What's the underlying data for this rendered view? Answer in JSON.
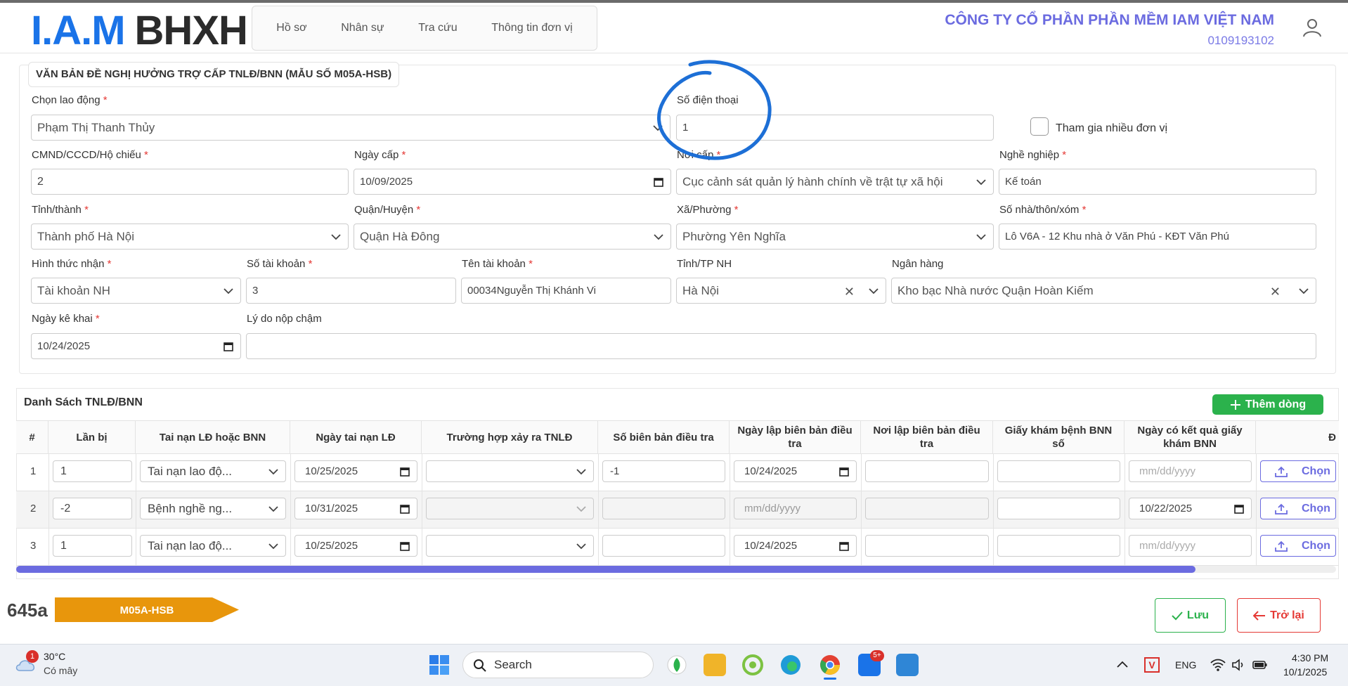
{
  "header": {
    "logo_iam": "I.A.M",
    "logo_bhxh": "BHXH",
    "nav": [
      "Hồ sơ",
      "Nhân sự",
      "Tra cứu",
      "Thông tin đơn vị"
    ],
    "company": "CÔNG TY CỔ PHẦN PHẦN MỀM IAM VIỆT NAM",
    "taxcode": "0109193102"
  },
  "form": {
    "legend": "VĂN BẢN ĐỀ NGHỊ HƯỞNG TRỢ CẤP TNLĐ/BNN (MẪU SỐ M05A-HSB)",
    "employee_label": "Chọn lao động",
    "employee_value": "Phạm Thị Thanh Thủy",
    "phone_label": "Số điện thoại",
    "phone_value": "1",
    "multi_unit_label": "Tham gia nhiều đơn vị",
    "id_label": "CMND/CCCD/Hộ chiếu",
    "id_value": "2",
    "issue_date_label": "Ngày cấp",
    "issue_date_value": "10/09/2025",
    "issue_place_label": "Nơi cấp",
    "issue_place_value": "Cục cảnh sát quản lý hành chính về trật tự xã hội",
    "job_label": "Nghề nghiệp",
    "job_value": "Kế toán",
    "province_label": "Tỉnh/thành",
    "province_value": "Thành phố Hà Nội",
    "district_label": "Quận/Huyện",
    "district_value": "Quận Hà Đông",
    "ward_label": "Xã/Phường",
    "ward_value": "Phường Yên Nghĩa",
    "address_label": "Số nhà/thôn/xóm",
    "address_value": "Lô V6A - 12 Khu nhà ở Văn Phú - KĐT Văn Phú",
    "receive_label": "Hình thức nhận",
    "receive_value": "Tài khoản NH",
    "account_no_label": "Số tài khoản",
    "account_no_value": "3",
    "account_name_label": "Tên tài khoản",
    "account_name_value": "00034Nguyễn Thị Khánh Vi",
    "bank_city_label": "Tỉnh/TP NH",
    "bank_city_value": "Hà Nội",
    "bank_label": "Ngân hàng",
    "bank_value": "Kho bạc Nhà nước Quận Hoàn Kiếm",
    "declare_date_label": "Ngày kê khai",
    "declare_date_value": "10/24/2025",
    "late_reason_label": "Lý do nộp chậm",
    "late_reason_value": ""
  },
  "table": {
    "title": "Danh Sách TNLĐ/BNN",
    "add_label": "Thêm dòng",
    "headers": [
      "#",
      "Lần bị",
      "Tai nạn LĐ hoặc BNN",
      "Ngày tai nạn LĐ",
      "Trường hợp xảy ra TNLĐ",
      "Số biên bản điều tra",
      "Ngày lập biên bản điều tra",
      "Nơi lập biên bản điều tra",
      "Giấy khám bệnh BNN số",
      "Ngày có kết quả giấy khám BNN",
      "Đ"
    ],
    "choose_label": "Chọn",
    "date_placeholder": "mm/dd/yyyy",
    "rows": [
      {
        "no": "1",
        "times": "1",
        "type": "Tai nạn lao độ...",
        "date": "10/25/2025",
        "case": "",
        "report_no": "-1",
        "report_date": "10/24/2025",
        "report_place": "",
        "exam_no": "",
        "exam_date": "mm/dd/yyyy"
      },
      {
        "no": "2",
        "times": "-2",
        "type": "Bệnh nghề ng...",
        "date": "10/31/2025",
        "case": "",
        "report_no": "",
        "report_date": "mm/dd/yyyy",
        "report_place": "",
        "exam_no": "",
        "exam_date": "10/22/2025"
      },
      {
        "no": "3",
        "times": "1",
        "type": "Tai nạn lao độ...",
        "date": "10/25/2025",
        "case": "",
        "report_no": "",
        "report_date": "10/24/2025",
        "report_place": "",
        "exam_no": "",
        "exam_date": "mm/dd/yyyy"
      }
    ]
  },
  "footer": {
    "code": "645a",
    "form_tag": "M05A-HSB",
    "save_label": "Lưu",
    "back_label": "Trở lại"
  },
  "taskbar": {
    "weather_badge": "1",
    "temp": "30°C",
    "weather_desc": "Có mây",
    "search_placeholder": "Search",
    "zalo_badge": "5+",
    "lang": "ENG",
    "time": "4:30 PM",
    "date": "10/1/2025"
  },
  "colors": {
    "accent": "#6b6be0",
    "brand_blue": "#1a73e8",
    "success": "#2bb24c",
    "danger": "#e53935",
    "tag_orange": "#e8960c",
    "annotation": "#1d6fd6"
  }
}
